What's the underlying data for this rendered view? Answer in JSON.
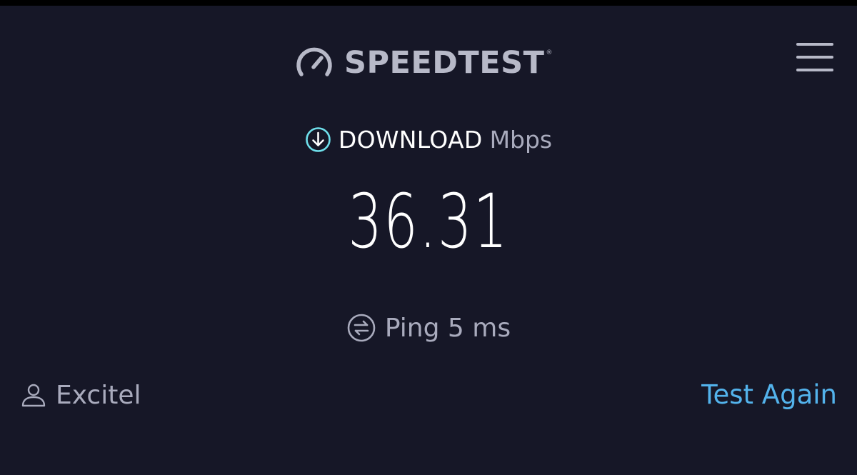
{
  "header": {
    "logo_text": "SPEEDTEST",
    "logo_mark": "®",
    "logo_icon": "speedometer-icon",
    "menu_icon": "hamburger-menu-icon"
  },
  "result": {
    "label": "DOWNLOAD",
    "unit": "Mbps",
    "value": "36.31",
    "icon": "download-arrow-icon"
  },
  "ping": {
    "text": "Ping 5 ms",
    "icon": "ping-icon"
  },
  "footer": {
    "provider": "Excitel",
    "provider_icon": "user-icon",
    "test_again_label": "Test Again"
  },
  "colors": {
    "background": "#161727",
    "primary_text": "#ffffff",
    "secondary_text": "#a9abbd",
    "accent_blue": "#53b3ec",
    "download_cyan": "#6fe0ec"
  }
}
